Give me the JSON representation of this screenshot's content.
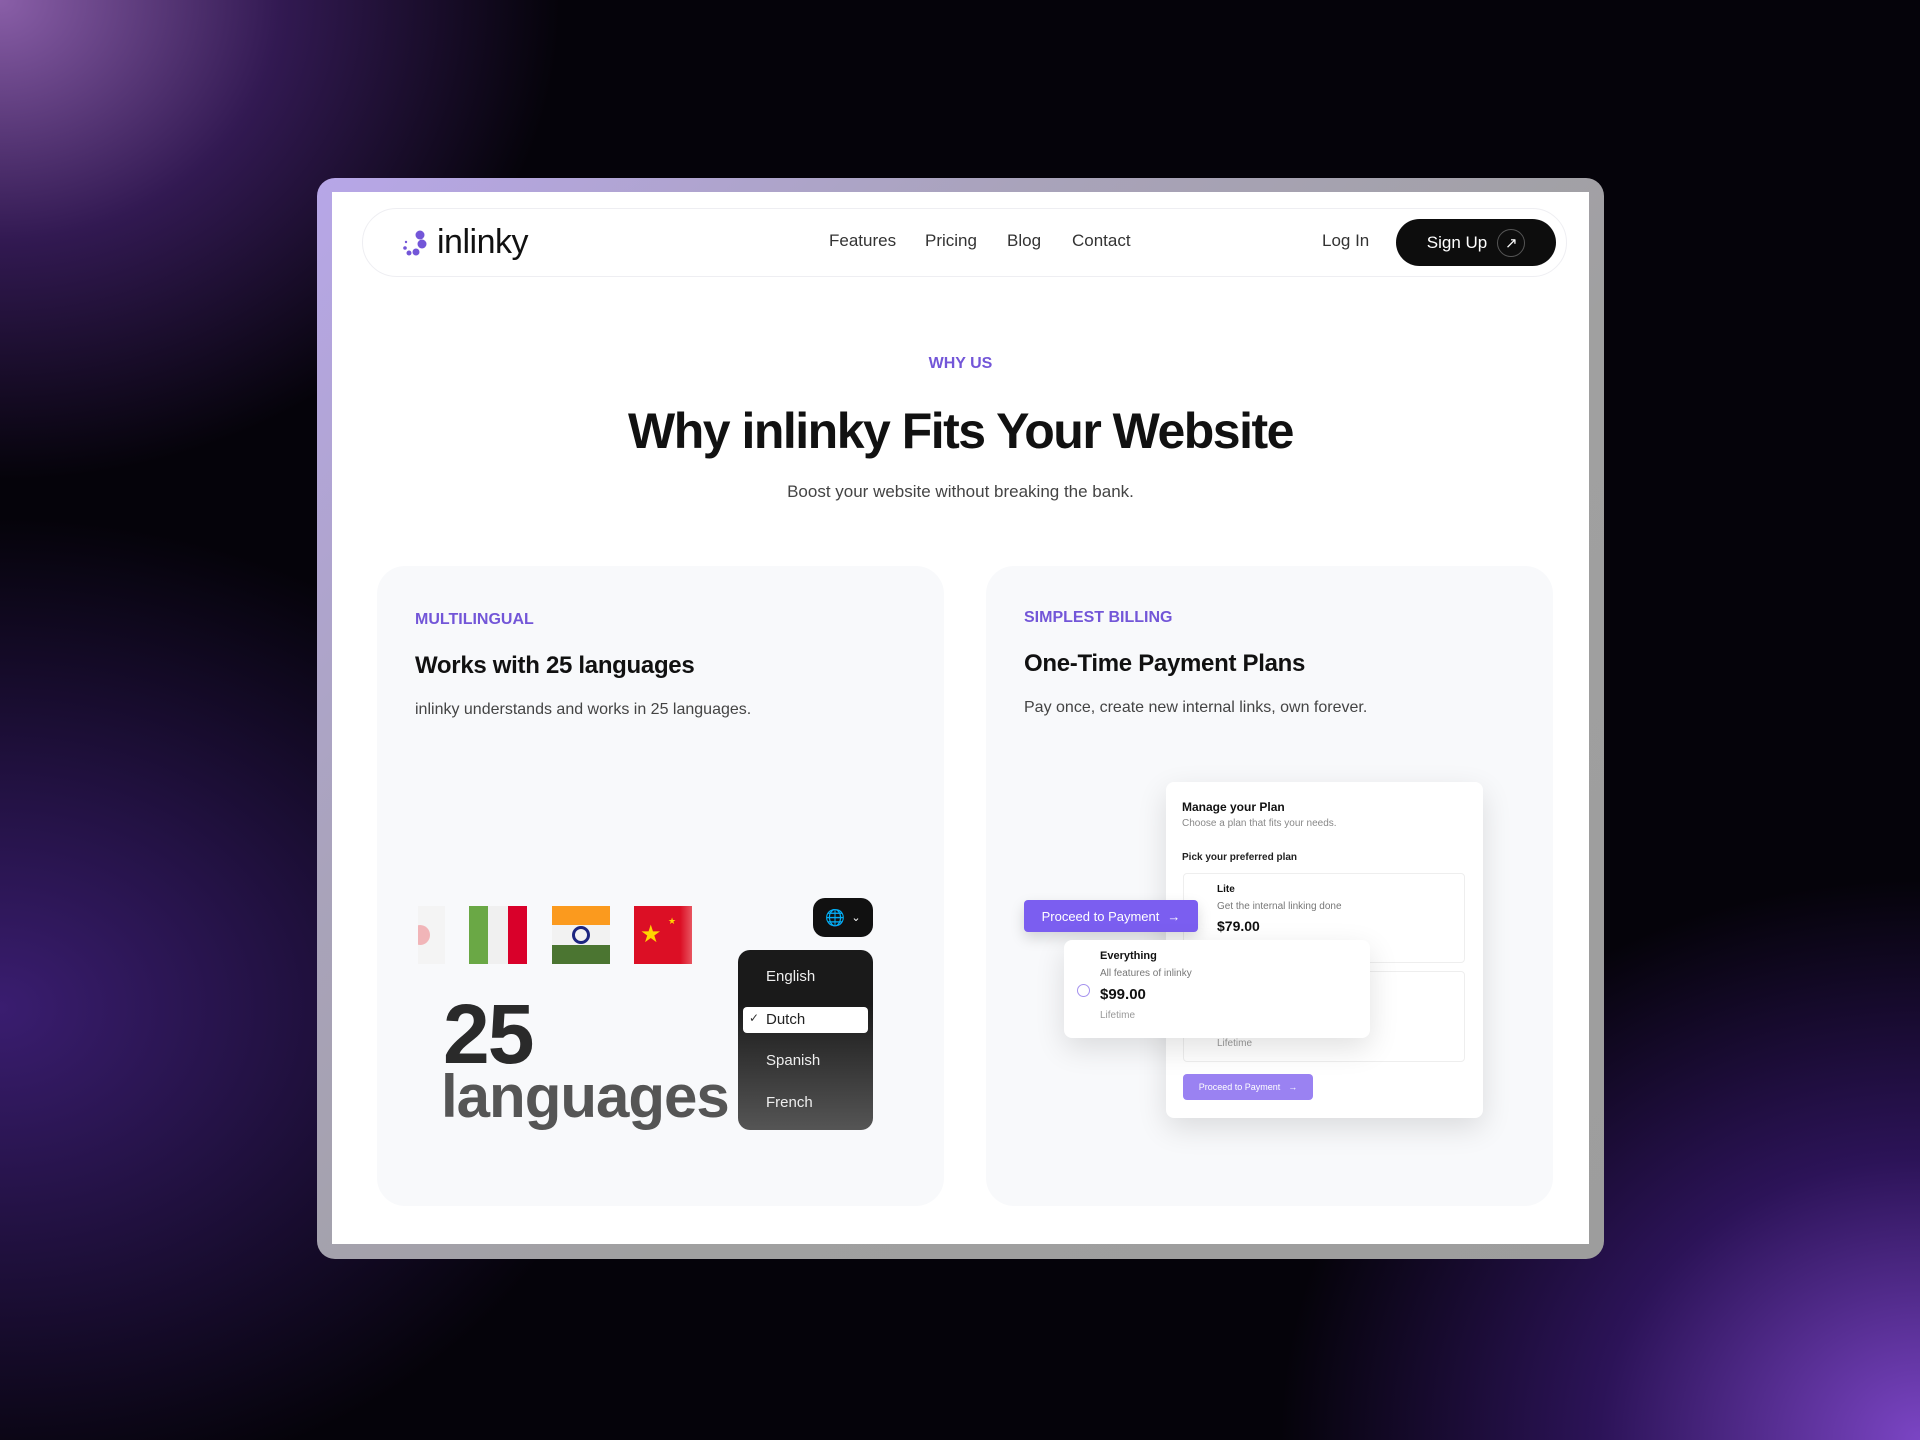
{
  "nav": {
    "logo": "inlinky",
    "links": [
      "Features",
      "Pricing",
      "Blog",
      "Contact"
    ],
    "login": "Log In",
    "signup": "Sign Up"
  },
  "hero": {
    "eyebrow": "WHY US",
    "title": "Why inlinky Fits Your Website",
    "subtitle": "Boost your website without breaking the bank."
  },
  "multilingual": {
    "label": "MULTILINGUAL",
    "title": "Works with 25 languages",
    "desc": "inlinky understands and works in 25 languages.",
    "big_number": "25",
    "big_word": "languages",
    "flags": [
      "japan-flag",
      "italy-flag",
      "india-flag",
      "china-flag"
    ],
    "languages": [
      "English",
      "Dutch",
      "Spanish",
      "French"
    ],
    "selected": "Dutch"
  },
  "billing": {
    "label": "SIMPLEST BILLING",
    "title": "One-Time Payment Plans",
    "desc": "Pay once, create new internal links, own forever.",
    "mock": {
      "title": "Manage your Plan",
      "subtitle": "Choose a plan that fits your needs.",
      "pick": "Pick your preferred plan",
      "lite": {
        "name": "Lite",
        "desc": "Get the internal linking done",
        "price": "$79.00"
      },
      "everything": {
        "name": "Everything",
        "desc": "All features of inlinky",
        "price": "$99.00",
        "term": "Lifetime"
      },
      "behind_term": "Lifetime",
      "proceed": "Proceed to Payment"
    }
  },
  "colors": {
    "accent": "#7356d8",
    "button": "#7b5ef0",
    "dark": "#0d0d0d"
  }
}
